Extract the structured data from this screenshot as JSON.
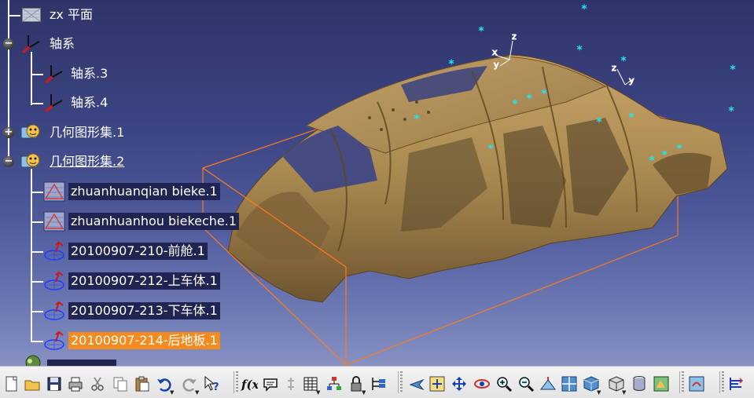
{
  "colors": {
    "viewport_top": "#2f3468",
    "viewport_bottom": "#8791c2",
    "body_in_white": "#a8884f",
    "bounding_box": "#ff7a1a",
    "marker": "#22e5f0",
    "selected_highlight": "#f58a1f"
  },
  "tree": {
    "nodes": [
      {
        "label": "zx 平面",
        "icon": "plane-icon",
        "expander": "",
        "style": "plain"
      },
      {
        "label": "轴系",
        "icon": "axis-system-icon",
        "expander": "−",
        "style": "plain"
      },
      {
        "label": "轴系.3",
        "icon": "axis-system-icon",
        "expander": "",
        "style": "plain"
      },
      {
        "label": "轴系.4",
        "icon": "axis-system-icon",
        "expander": "",
        "style": "plain"
      },
      {
        "label": "几何图形集.1",
        "icon": "geometrical-set-icon",
        "expander": "+",
        "style": "plain"
      },
      {
        "label": "几何图形集.2",
        "icon": "geometrical-set-icon",
        "expander": "−",
        "style": "underlined"
      },
      {
        "label": "zhuanhuanqian bieke.1",
        "icon": "cloud-points-icon",
        "expander": "",
        "style": "boxed"
      },
      {
        "label": "zhuanhuanhou biekeche.1",
        "icon": "cloud-points-icon",
        "expander": "",
        "style": "boxed"
      },
      {
        "label": "20100907-210-前舱.1",
        "icon": "mesh-icon",
        "expander": "",
        "style": "boxed"
      },
      {
        "label": "20100907-212-上车体.1",
        "icon": "mesh-icon",
        "expander": "",
        "style": "boxed"
      },
      {
        "label": "20100907-213-下车体.1",
        "icon": "mesh-icon",
        "expander": "",
        "style": "boxed"
      },
      {
        "label": "20100907-214-后地板.1",
        "icon": "mesh-icon",
        "expander": "",
        "style": "selected"
      }
    ]
  },
  "toolbar": {
    "buttons": [
      {
        "icon": "new-icon",
        "dropdown": false
      },
      {
        "icon": "open-icon",
        "dropdown": false
      },
      {
        "icon": "save-icon",
        "dropdown": false
      },
      {
        "icon": "print-icon",
        "dropdown": false
      },
      {
        "icon": "cut-icon",
        "dropdown": false
      },
      {
        "icon": "copy-icon",
        "dropdown": false
      },
      {
        "icon": "paste-icon",
        "dropdown": false
      },
      {
        "icon": "undo-icon",
        "dropdown": true
      },
      {
        "icon": "redo-icon",
        "dropdown": true
      },
      {
        "icon": "whats-this-icon",
        "dropdown": false
      },
      {
        "icon": "formula-icon",
        "dropdown": false
      },
      {
        "icon": "comment-icon",
        "dropdown": false
      },
      {
        "icon": "knowledge-icon",
        "dropdown": false
      },
      {
        "icon": "table-icon",
        "dropdown": true
      },
      {
        "icon": "tree-expand-icon",
        "dropdown": false
      },
      {
        "icon": "lock-icon",
        "dropdown": true
      },
      {
        "icon": "selection-icon",
        "dropdown": false
      },
      {
        "icon": "fly-mode-icon",
        "dropdown": false
      },
      {
        "icon": "fit-all-icon",
        "dropdown": false
      },
      {
        "icon": "pan-icon",
        "dropdown": false
      },
      {
        "icon": "rotate-icon",
        "dropdown": false
      },
      {
        "icon": "zoom-in-icon",
        "dropdown": false
      },
      {
        "icon": "zoom-out-icon",
        "dropdown": false
      },
      {
        "icon": "normal-view-icon",
        "dropdown": false
      },
      {
        "icon": "multi-view-icon",
        "dropdown": false
      },
      {
        "icon": "isometric-view-icon",
        "dropdown": true
      },
      {
        "icon": "shading-icon",
        "dropdown": true
      },
      {
        "icon": "hide-show-icon",
        "dropdown": false
      },
      {
        "icon": "swap-space-icon",
        "dropdown": false
      },
      {
        "icon": "update-icon",
        "dropdown": false
      },
      {
        "icon": "measure-icon",
        "dropdown": false
      },
      {
        "icon": "measure-item-icon",
        "dropdown": false
      }
    ]
  }
}
